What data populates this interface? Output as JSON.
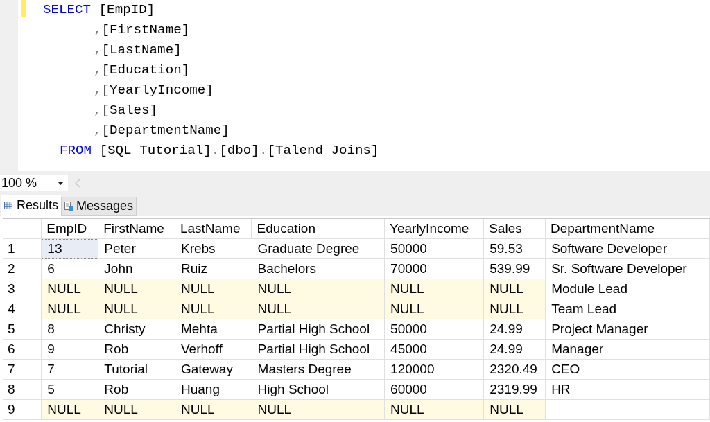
{
  "editor": {
    "lines": [
      {
        "kind": "statement",
        "tokens": [
          {
            "kind": "keyword",
            "text": "SELECT"
          },
          {
            "kind": "plain",
            "text": " [EmpID]"
          }
        ]
      },
      {
        "kind": "continuation",
        "tokens": [
          {
            "kind": "punct",
            "text": ","
          },
          {
            "kind": "plain",
            "text": "[FirstName]"
          }
        ]
      },
      {
        "kind": "continuation",
        "tokens": [
          {
            "kind": "punct",
            "text": ","
          },
          {
            "kind": "plain",
            "text": "[LastName]"
          }
        ]
      },
      {
        "kind": "continuation",
        "tokens": [
          {
            "kind": "punct",
            "text": ","
          },
          {
            "kind": "plain",
            "text": "[Education]"
          }
        ]
      },
      {
        "kind": "continuation",
        "tokens": [
          {
            "kind": "punct",
            "text": ","
          },
          {
            "kind": "plain",
            "text": "[YearlyIncome]"
          }
        ]
      },
      {
        "kind": "continuation",
        "tokens": [
          {
            "kind": "punct",
            "text": ","
          },
          {
            "kind": "plain",
            "text": "[Sales]"
          }
        ]
      },
      {
        "kind": "continuation",
        "tokens": [
          {
            "kind": "punct",
            "text": ","
          },
          {
            "kind": "plain",
            "text": "[DepartmentName]"
          },
          {
            "kind": "cursor"
          }
        ]
      },
      {
        "kind": "clause",
        "tokens": [
          {
            "kind": "keyword",
            "text": "FROM"
          },
          {
            "kind": "plain",
            "text": " [SQL Tutorial]"
          },
          {
            "kind": "punct",
            "text": "."
          },
          {
            "kind": "plain",
            "text": "[dbo]"
          },
          {
            "kind": "punct",
            "text": "."
          },
          {
            "kind": "plain",
            "text": "[Talend_Joins]"
          }
        ]
      }
    ]
  },
  "zoom": {
    "value": "100 %"
  },
  "tabs": [
    {
      "label": "Results",
      "kind": "grid",
      "selected": true
    },
    {
      "label": "Messages",
      "kind": "messages",
      "selected": false
    }
  ],
  "grid": {
    "columns": [
      "EmpID",
      "FirstName",
      "LastName",
      "Education",
      "YearlyIncome",
      "Sales",
      "DepartmentName"
    ],
    "rows": [
      {
        "number": "1",
        "cells": [
          {
            "text": "13",
            "kind": "value",
            "selected": true
          },
          {
            "text": "Peter",
            "kind": "value",
            "selected": false
          },
          {
            "text": "Krebs",
            "kind": "value",
            "selected": false
          },
          {
            "text": "Graduate Degree",
            "kind": "value",
            "selected": false
          },
          {
            "text": "50000",
            "kind": "value",
            "selected": false
          },
          {
            "text": "59.53",
            "kind": "value",
            "selected": false
          },
          {
            "text": "Software Developer",
            "kind": "value",
            "selected": false
          }
        ]
      },
      {
        "number": "2",
        "cells": [
          {
            "text": "6",
            "kind": "value",
            "selected": false
          },
          {
            "text": "John",
            "kind": "value",
            "selected": false
          },
          {
            "text": "Ruiz",
            "kind": "value",
            "selected": false
          },
          {
            "text": "Bachelors",
            "kind": "value",
            "selected": false
          },
          {
            "text": "70000",
            "kind": "value",
            "selected": false
          },
          {
            "text": "539.99",
            "kind": "value",
            "selected": false
          },
          {
            "text": "Sr. Software Developer",
            "kind": "value",
            "selected": false
          }
        ]
      },
      {
        "number": "3",
        "cells": [
          {
            "text": "NULL",
            "kind": "null",
            "selected": false
          },
          {
            "text": "NULL",
            "kind": "null",
            "selected": false
          },
          {
            "text": "NULL",
            "kind": "null",
            "selected": false
          },
          {
            "text": "NULL",
            "kind": "null",
            "selected": false
          },
          {
            "text": "NULL",
            "kind": "null",
            "selected": false
          },
          {
            "text": "NULL",
            "kind": "null",
            "selected": false
          },
          {
            "text": "Module Lead",
            "kind": "value",
            "selected": false
          }
        ]
      },
      {
        "number": "4",
        "cells": [
          {
            "text": "NULL",
            "kind": "null",
            "selected": false
          },
          {
            "text": "NULL",
            "kind": "null",
            "selected": false
          },
          {
            "text": "NULL",
            "kind": "null",
            "selected": false
          },
          {
            "text": "NULL",
            "kind": "null",
            "selected": false
          },
          {
            "text": "NULL",
            "kind": "null",
            "selected": false
          },
          {
            "text": "NULL",
            "kind": "null",
            "selected": false
          },
          {
            "text": "Team Lead",
            "kind": "value",
            "selected": false
          }
        ]
      },
      {
        "number": "5",
        "cells": [
          {
            "text": "8",
            "kind": "value",
            "selected": false
          },
          {
            "text": "Christy",
            "kind": "value",
            "selected": false
          },
          {
            "text": "Mehta",
            "kind": "value",
            "selected": false
          },
          {
            "text": "Partial High School",
            "kind": "value",
            "selected": false
          },
          {
            "text": "50000",
            "kind": "value",
            "selected": false
          },
          {
            "text": "24.99",
            "kind": "value",
            "selected": false
          },
          {
            "text": "Project Manager",
            "kind": "value",
            "selected": false
          }
        ]
      },
      {
        "number": "6",
        "cells": [
          {
            "text": "9",
            "kind": "value",
            "selected": false
          },
          {
            "text": "Rob",
            "kind": "value",
            "selected": false
          },
          {
            "text": "Verhoff",
            "kind": "value",
            "selected": false
          },
          {
            "text": "Partial High School",
            "kind": "value",
            "selected": false
          },
          {
            "text": "45000",
            "kind": "value",
            "selected": false
          },
          {
            "text": "24.99",
            "kind": "value",
            "selected": false
          },
          {
            "text": "Manager",
            "kind": "value",
            "selected": false
          }
        ]
      },
      {
        "number": "7",
        "cells": [
          {
            "text": "7",
            "kind": "value",
            "selected": false
          },
          {
            "text": "Tutorial",
            "kind": "value",
            "selected": false
          },
          {
            "text": "Gateway",
            "kind": "value",
            "selected": false
          },
          {
            "text": "Masters Degree",
            "kind": "value",
            "selected": false
          },
          {
            "text": "120000",
            "kind": "value",
            "selected": false
          },
          {
            "text": "2320.49",
            "kind": "value",
            "selected": false
          },
          {
            "text": "CEO",
            "kind": "value",
            "selected": false
          }
        ]
      },
      {
        "number": "8",
        "cells": [
          {
            "text": "5",
            "kind": "value",
            "selected": false
          },
          {
            "text": "Rob",
            "kind": "value",
            "selected": false
          },
          {
            "text": "Huang",
            "kind": "value",
            "selected": false
          },
          {
            "text": "High School",
            "kind": "value",
            "selected": false
          },
          {
            "text": "60000",
            "kind": "value",
            "selected": false
          },
          {
            "text": "2319.99",
            "kind": "value",
            "selected": false
          },
          {
            "text": "HR",
            "kind": "value",
            "selected": false
          }
        ]
      },
      {
        "number": "9",
        "cells": [
          {
            "text": "NULL",
            "kind": "null",
            "selected": false
          },
          {
            "text": "NULL",
            "kind": "null",
            "selected": false
          },
          {
            "text": "NULL",
            "kind": "null",
            "selected": false
          },
          {
            "text": "NULL",
            "kind": "null",
            "selected": false
          },
          {
            "text": "NULL",
            "kind": "null",
            "selected": false
          },
          {
            "text": "NULL",
            "kind": "null",
            "selected": false
          },
          {
            "kind": "empty",
            "selected": false
          }
        ]
      }
    ]
  }
}
